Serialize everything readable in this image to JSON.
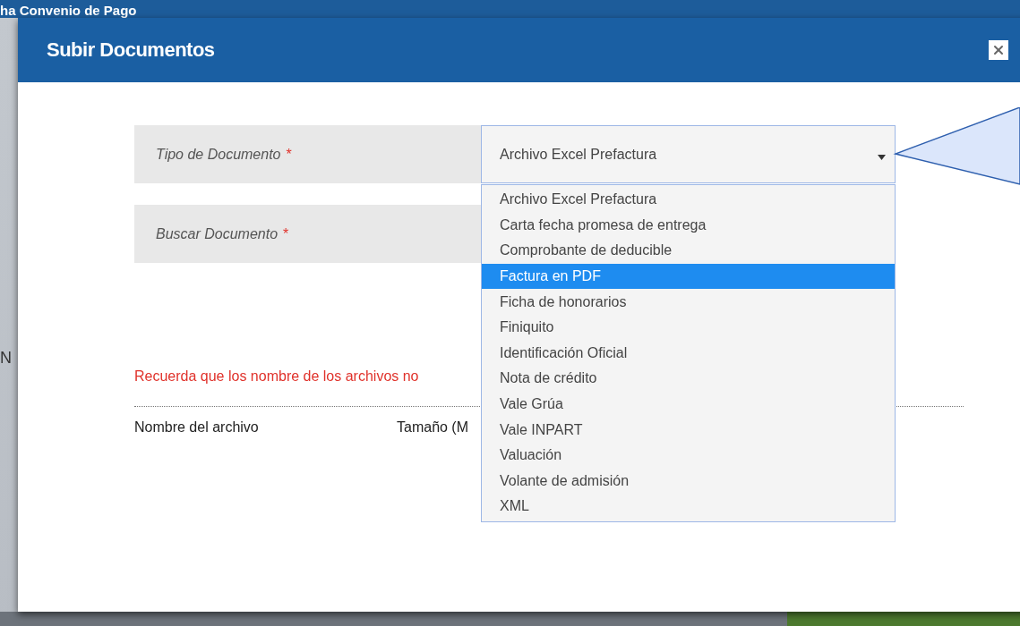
{
  "background_page": {
    "title": "ha Convenio de Pago",
    "side_text": "N"
  },
  "dialog": {
    "title": "Subir Documentos",
    "fields": [
      {
        "label": "Tipo de Documento",
        "required_mark": "*",
        "value": "Archivo Excel Prefactura",
        "expanded": true
      },
      {
        "label": "Buscar Documento",
        "required_mark": "*"
      }
    ],
    "options": [
      {
        "label": "Archivo Excel Prefactura",
        "selected": false
      },
      {
        "label": "Carta fecha promesa de entrega",
        "selected": false
      },
      {
        "label": "Comprobante de deducible",
        "selected": false
      },
      {
        "label": "Factura en PDF",
        "selected": true
      },
      {
        "label": "Ficha de honorarios",
        "selected": false
      },
      {
        "label": "Finiquito",
        "selected": false
      },
      {
        "label": "Identificación Oficial",
        "selected": false
      },
      {
        "label": "Nota de crédito",
        "selected": false
      },
      {
        "label": "Vale Grúa",
        "selected": false
      },
      {
        "label": "Vale INPART",
        "selected": false
      },
      {
        "label": "Valuación",
        "selected": false
      },
      {
        "label": "Volante de admisión",
        "selected": false
      },
      {
        "label": "XML",
        "selected": false
      }
    ],
    "warning": "Recuerda que los nombre de los archivos no",
    "table": {
      "columns": [
        "Nombre del archivo",
        "Tamaño (M"
      ]
    }
  }
}
